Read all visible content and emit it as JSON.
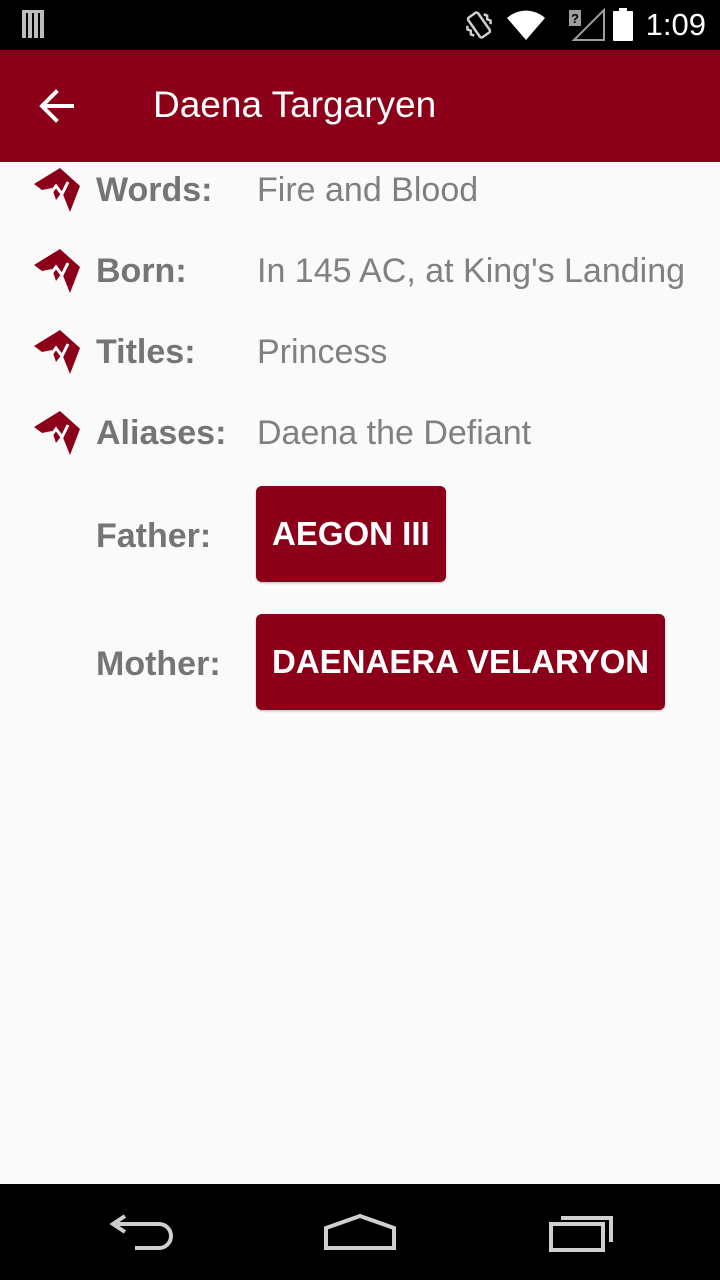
{
  "status_bar": {
    "time": "1:09",
    "icons": [
      "notification-bars-icon",
      "vibrate-icon",
      "wifi-icon",
      "signal-icon",
      "battery-icon"
    ]
  },
  "app_bar": {
    "title": "Daena Targaryen",
    "back_icon": "arrow-back-icon",
    "color": "#8b0018"
  },
  "details": [
    {
      "label": "Words:",
      "value": "Fire and Blood",
      "icon": "house-sigil-icon"
    },
    {
      "label": "Born:",
      "value": "In 145 AC, at King's Landing",
      "icon": "house-sigil-icon"
    },
    {
      "label": "Titles:",
      "value": "Princess",
      "icon": "house-sigil-icon"
    },
    {
      "label": "Aliases:",
      "value": "Daena the Defiant",
      "icon": "house-sigil-icon"
    }
  ],
  "parents": {
    "father": {
      "label": "Father:",
      "button": "AEGON III"
    },
    "mother": {
      "label": "Mother:",
      "button": "DAENAERA VELARYON"
    }
  },
  "nav_bar": {
    "icons": [
      "back-nav-icon",
      "home-nav-icon",
      "recents-nav-icon"
    ]
  }
}
